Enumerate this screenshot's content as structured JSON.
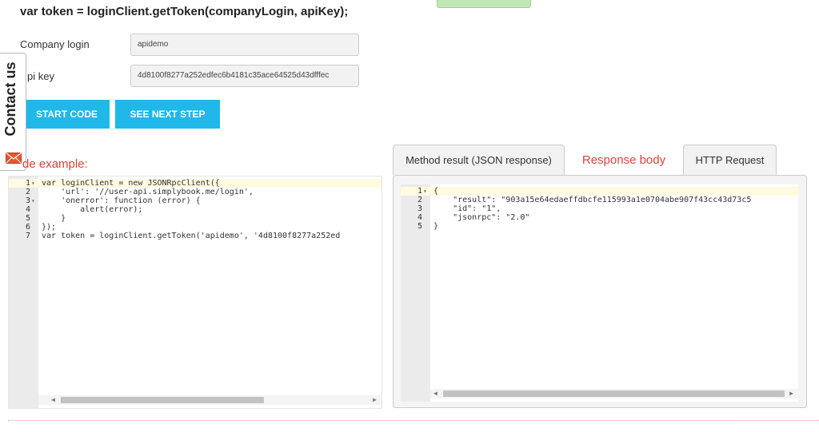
{
  "heading": "var token = loginClient.getToken(companyLogin, apiKey);",
  "form": {
    "company_login_label": "Company login",
    "company_login_value": "apidemo",
    "api_key_label": "pi key",
    "api_key_value": "4d8100f8277a252edfec6b4181c35ace64525d43dfffec"
  },
  "buttons": {
    "start_code": "START CODE",
    "see_next_step": "SEE NEXT STEP"
  },
  "contact_tab": {
    "label": "Contact us",
    "icon": "mail-icon"
  },
  "code_example_label": "de example:",
  "code_editor": {
    "lines": [
      {
        "n": "1",
        "fold": "▾",
        "text": "var loginClient = new JSONRpcClient({"
      },
      {
        "n": "2",
        "fold": "",
        "text": "    'url': '//user-api.simplybook.me/login',"
      },
      {
        "n": "3",
        "fold": "▾",
        "text": "    'onerror': function (error) {"
      },
      {
        "n": "4",
        "fold": "",
        "text": "        alert(error);"
      },
      {
        "n": "5",
        "fold": "",
        "text": "    }"
      },
      {
        "n": "6",
        "fold": "",
        "text": "});"
      },
      {
        "n": "7",
        "fold": "",
        "text": "var token = loginClient.getToken('apidemo', '4d8100f8277a252ed"
      }
    ]
  },
  "result_tabs": {
    "method_result": "Method result (JSON response)",
    "response_body": "Response body",
    "http_request": "HTTP Request"
  },
  "response_editor": {
    "lines": [
      {
        "n": "1",
        "fold": "▾",
        "text": "{"
      },
      {
        "n": "2",
        "fold": "",
        "text": "    \"result\": \"903a15e64edaeffdbcfe115993a1e0704abe907f43cc43d73c5"
      },
      {
        "n": "3",
        "fold": "",
        "text": "    \"id\": \"1\","
      },
      {
        "n": "4",
        "fold": "",
        "text": "    \"jsonrpc\": \"2.0\""
      },
      {
        "n": "5",
        "fold": "",
        "text": "}"
      }
    ]
  },
  "colors": {
    "accent_button": "#1fb8e8",
    "section_label": "#d9443a",
    "active_tab": "#d9443a"
  }
}
